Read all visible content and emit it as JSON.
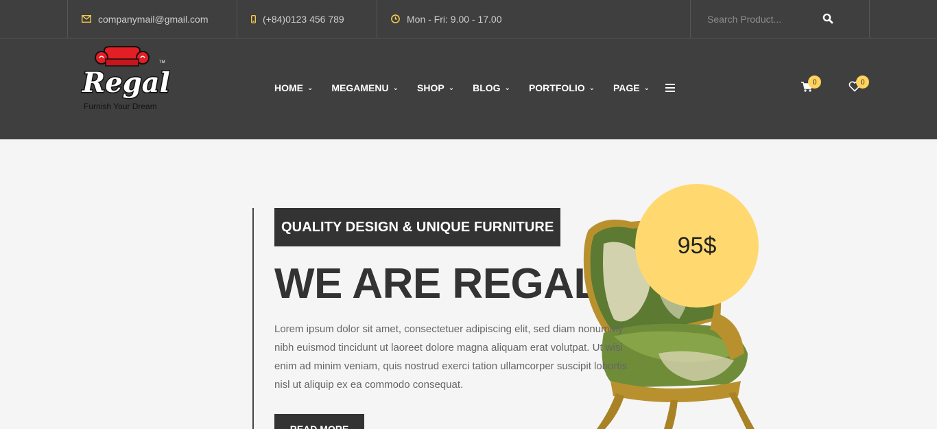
{
  "topbar": {
    "email": "companymail@gmail.com",
    "phone": "(+84)0123 456 789",
    "hours": "Mon - Fri: 9.00 - 17.00",
    "search_placeholder": "Search Product..."
  },
  "brand": {
    "tagline": "Furnish Your Dream"
  },
  "nav": {
    "items": [
      {
        "label": "HOME"
      },
      {
        "label": "MEGAMENU"
      },
      {
        "label": "SHOP"
      },
      {
        "label": "BLOG"
      },
      {
        "label": "PORTFOLIO"
      },
      {
        "label": "PAGE"
      }
    ]
  },
  "header": {
    "cart_count": "0",
    "wishlist_count": "0"
  },
  "hero": {
    "kicker": "QUALITY DESIGN & UNIQUE FURNITURE",
    "headline": "WE ARE REGAL",
    "paragraph": "Lorem ipsum dolor sit amet, consectetuer adipiscing elit, sed diam nonummy nibh euismod tincidunt ut laoreet dolore magna aliquam erat volutpat. Ut wisi enim ad minim veniam, quis nostrud exerci tation ullamcorper suscipit lobortis nisl ut aliquip ex ea commodo consequat.",
    "button": "READ MORE",
    "price": "95$"
  },
  "colors": {
    "accent": "#ffd96f",
    "dark": "#3f3f3f",
    "logo_red": "#e31e24"
  }
}
